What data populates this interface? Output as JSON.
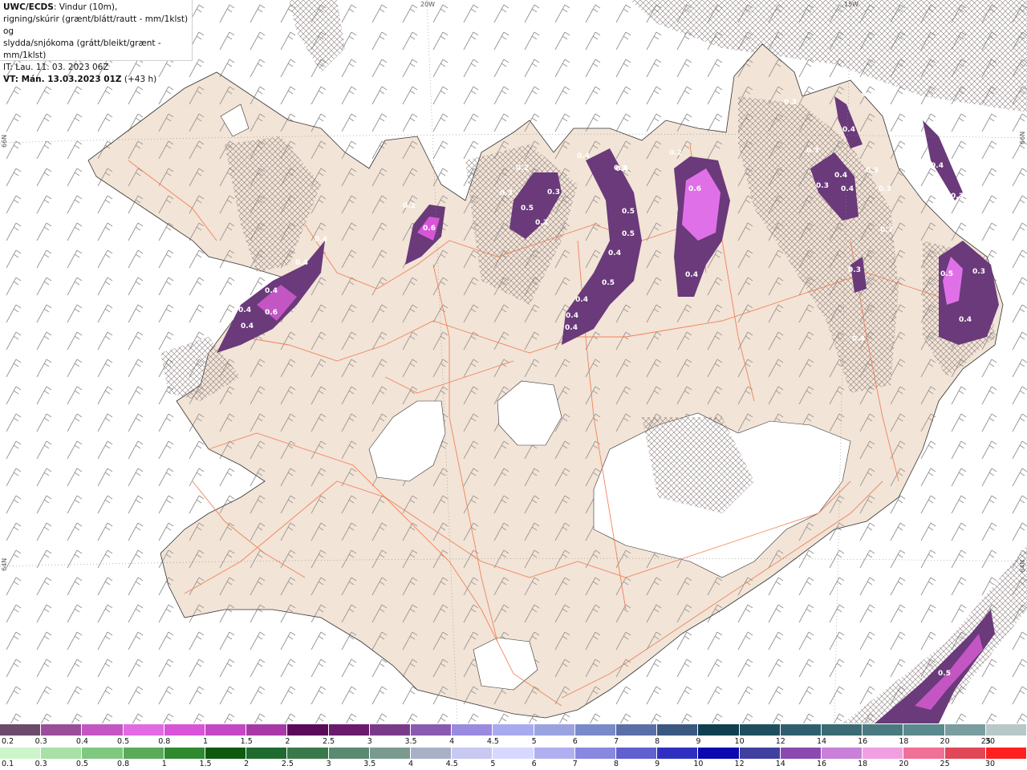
{
  "header": {
    "title_bold": "UWC/ECDS",
    "title_rest": ": Vindur (10m),",
    "line2": "rigning/skúrir (grænt/blátt/rautt - mm/1klst) og",
    "line3": "slydda/snjókoma (grátt/bleikt/grænt - mm/1klst)",
    "line4": "IT: Lau. 11. 03. 2023 06Z",
    "line5_bold": "VT: Mán. 13.03.2023 01Z",
    "line5_rest": " (+43 h)"
  },
  "grid_labels": {
    "top_20w": "20W",
    "top_15w": "15W",
    "left_66n": "66N",
    "left_64n": "64N",
    "right_66n": "66N",
    "right_64n": "64N"
  },
  "precip_labels": [
    "0.4",
    "0.4",
    "0.6",
    "0.4",
    "0.4",
    "0.4",
    "0.6",
    "0.2",
    "0.2",
    "0.4",
    "0.3",
    "0.3",
    "0.5",
    "0.3",
    "0.4",
    "0.3",
    "0.5",
    "0.5",
    "0.4",
    "0.5",
    "0.4",
    "0.4",
    "0.4",
    "0.2",
    "0.6",
    "0.4",
    "0.3",
    "0.4",
    "0.3",
    "0.3",
    "0.4",
    "0.4",
    "0.3",
    "0.3",
    "0.3",
    "0.3",
    "0.4",
    "0.3",
    "0.4",
    "0.5",
    "0.3",
    "0.4",
    "0.3",
    "0.4",
    "0.5"
  ],
  "legend_top": {
    "labels": [
      "0.2",
      "0.3",
      "0.4",
      "0.5",
      "0.8",
      "1",
      "1.5",
      "2",
      "2.5",
      "3",
      "3.5",
      "4",
      "4.5",
      "5",
      "6",
      "7",
      "8",
      "9",
      "10",
      "12",
      "14",
      "16",
      "18",
      "20",
      "25",
      "30"
    ],
    "colors": [
      "#6b4a6b",
      "#9a4e9a",
      "#c456c4",
      "#e26ae2",
      "#d855d8",
      "#c448c4",
      "#a83aa8",
      "#5a0a5a",
      "#6a1a6a",
      "#7a3a8a",
      "#8a5ab0",
      "#9a8ae0",
      "#a8aaf0",
      "#9aa2e0",
      "#7a8ac8",
      "#5a6fa8",
      "#3a5880",
      "#0f3f50",
      "#1f4f5f",
      "#2f5f6f",
      "#3a6a72",
      "#4a7a80",
      "#5a8a8e",
      "#7a9ea0",
      "#b8c8c8"
    ]
  },
  "legend_bottom": {
    "labels": [
      "0.1",
      "0.3",
      "0.5",
      "0.8",
      "1",
      "1.5",
      "2",
      "2.5",
      "3",
      "3.5",
      "4",
      "4.5",
      "5",
      "6",
      "7",
      "8",
      "9",
      "10",
      "12",
      "14",
      "16",
      "18",
      "20",
      "25",
      "30"
    ],
    "colors": [
      "#ccf5cc",
      "#a8e0a8",
      "#80c880",
      "#5aaa5a",
      "#2f8a2f",
      "#0f5a0f",
      "#1f6a2f",
      "#3a7a4a",
      "#5a8a70",
      "#7a9a90",
      "#a8b0c8",
      "#c8c8f0",
      "#d8d8ff",
      "#b0b0f0",
      "#8888e0",
      "#6060d0",
      "#3030c0",
      "#0a0ab0",
      "#4040a0",
      "#8a4ab0",
      "#c880d8",
      "#f0a0e0",
      "#f07098",
      "#e04858",
      "#ff2020"
    ]
  },
  "colors": {
    "land": "#f2e4d6",
    "sea": "#ffffff",
    "glacier": "#ffffff",
    "roads": "#f07850",
    "hatch": "#7a6a6a",
    "precip_light": "#8a5a9a",
    "precip_mid": "#6a3a7a",
    "precip_high": "#e070e8"
  }
}
